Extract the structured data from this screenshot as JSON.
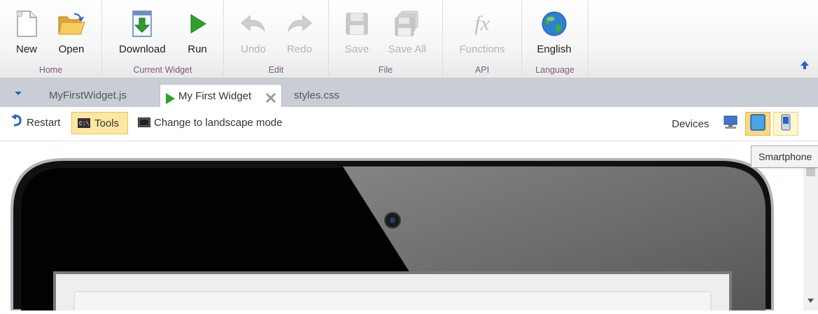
{
  "ribbon": {
    "groups": {
      "home": {
        "label": "Home",
        "new_label": "New",
        "open_label": "Open"
      },
      "current_widget": {
        "label": "Current Widget",
        "download_label": "Download",
        "run_label": "Run"
      },
      "edit": {
        "label": "Edit",
        "undo_label": "Undo",
        "redo_label": "Redo"
      },
      "file": {
        "label": "File",
        "save_label": "Save",
        "save_all_label": "Save All"
      },
      "api": {
        "label": "API",
        "functions_label": "Functions"
      },
      "language": {
        "label": "Language",
        "english_label": "English"
      }
    }
  },
  "tabs": [
    {
      "label": "MyFirstWidget.js"
    },
    {
      "label": "My First Widget",
      "active": true
    },
    {
      "label": "styles.css"
    }
  ],
  "toolbar": {
    "restart_label": "Restart",
    "tools_label": "Tools",
    "landscape_label": "Change to landscape mode",
    "devices_label": "Devices"
  },
  "tooltip": {
    "text": "Smartphone"
  },
  "colors": {
    "accent_green": "#2ea02e",
    "group_label": "#7b5a7b",
    "selected_bg": "#fbd882",
    "tab_strip": "#c9ced6"
  },
  "icons": [
    "new-page-icon",
    "open-folder-icon",
    "download-icon",
    "run-play-icon",
    "undo-icon",
    "redo-icon",
    "save-icon",
    "save-all-icon",
    "functions-fx-icon",
    "globe-icon",
    "collapse-arrow-icon",
    "dropdown-arrow-icon",
    "close-x-icon",
    "restart-icon",
    "console-icon",
    "monitor-icon",
    "desktop-device-icon",
    "tablet-device-icon",
    "smartphone-device-icon"
  ]
}
